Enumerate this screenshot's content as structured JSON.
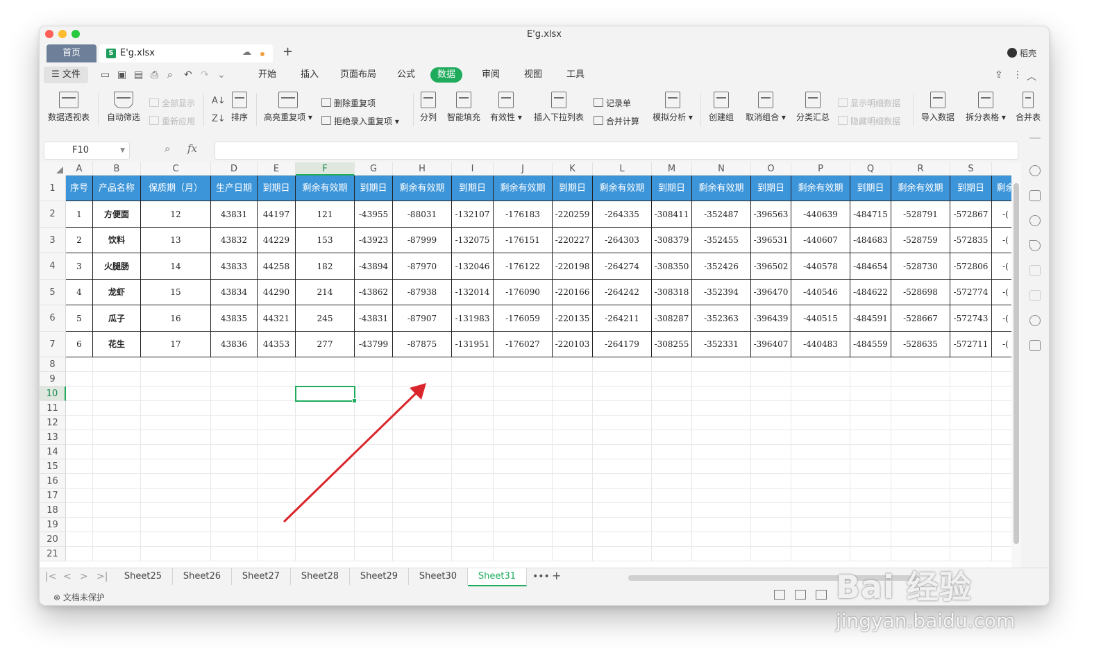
{
  "window": {
    "title": "E'g.xlsx"
  },
  "tabs": {
    "home": "首页",
    "file": "E'g.xlsx",
    "new_tab": "+"
  },
  "user": {
    "name": "稻壳"
  },
  "menu": {
    "file": "文件",
    "tabs": [
      "开始",
      "插入",
      "页面布局",
      "公式",
      "数据",
      "审阅",
      "视图",
      "工具"
    ],
    "active": "数据"
  },
  "ribbon": {
    "pivot": "数据透视表",
    "autofilter": "自动筛选",
    "show_all": "全部显示",
    "reapply": "重新应用",
    "sort": "排序",
    "highlight_dup": "高亮重复项",
    "delete_dup": "删除重复项",
    "reject_dup": "拒绝录入重复项",
    "split_col": "分列",
    "smart_fill": "智能填充",
    "validity": "有效性",
    "insert_dropdown": "插入下拉列表",
    "record_sheet": "记录单",
    "consolidate": "合并计算",
    "whatif": "模拟分析",
    "create_group": "创建组",
    "ungroup": "取消组合",
    "subtotal": "分类汇总",
    "show_detail": "显示明细数据",
    "hide_detail": "隐藏明细数据",
    "import_data": "导入数据",
    "split_table": "拆分表格",
    "merge_table": "合并表"
  },
  "formula_bar": {
    "name_box": "F10",
    "fx": "fx",
    "content": ""
  },
  "grid": {
    "columns": [
      "A",
      "B",
      "C",
      "D",
      "E",
      "F",
      "G",
      "H",
      "I",
      "J",
      "K",
      "L",
      "M",
      "N",
      "O",
      "P",
      "Q",
      "R",
      "S",
      ""
    ],
    "rows": [
      "1",
      "2",
      "3",
      "4",
      "5",
      "6",
      "7",
      "8",
      "9",
      "10",
      "11",
      "12",
      "13",
      "14",
      "15",
      "16",
      "17",
      "18",
      "19",
      "20",
      "21"
    ],
    "selected_cell": "F10",
    "header": [
      "序号",
      "产品名称",
      "保质期（月）",
      "生产日期",
      "到期日",
      "剩余有效期",
      "到期日",
      "剩余有效期",
      "到期日",
      "剩余有效期",
      "到期日",
      "剩余有效期",
      "到期日",
      "剩余有效期",
      "到期日",
      "剩余有效期",
      "到期日",
      "剩余有效期",
      "到期日",
      "剩余"
    ],
    "data": [
      [
        "1",
        "方便面",
        "12",
        "43831",
        "44197",
        "121",
        "-43955",
        "-88031",
        "-132107",
        "-176183",
        "-220259",
        "-264335",
        "-308411",
        "-352487",
        "-396563",
        "-440639",
        "-484715",
        "-528791",
        "-572867",
        "-("
      ],
      [
        "2",
        "饮料",
        "13",
        "43832",
        "44229",
        "153",
        "-43923",
        "-87999",
        "-132075",
        "-176151",
        "-220227",
        "-264303",
        "-308379",
        "-352455",
        "-396531",
        "-440607",
        "-484683",
        "-528759",
        "-572835",
        "-("
      ],
      [
        "3",
        "火腿肠",
        "14",
        "43833",
        "44258",
        "182",
        "-43894",
        "-87970",
        "-132046",
        "-176122",
        "-220198",
        "-264274",
        "-308350",
        "-352426",
        "-396502",
        "-440578",
        "-484654",
        "-528730",
        "-572806",
        "-("
      ],
      [
        "4",
        "龙虾",
        "15",
        "43834",
        "44290",
        "214",
        "-43862",
        "-87938",
        "-132014",
        "-176090",
        "-220166",
        "-264242",
        "-308318",
        "-352394",
        "-396470",
        "-440546",
        "-484622",
        "-528698",
        "-572774",
        "-("
      ],
      [
        "5",
        "瓜子",
        "16",
        "43835",
        "44321",
        "245",
        "-43831",
        "-87907",
        "-131983",
        "-176059",
        "-220135",
        "-264211",
        "-308287",
        "-352363",
        "-396439",
        "-440515",
        "-484591",
        "-528667",
        "-572743",
        "-("
      ],
      [
        "6",
        "花生",
        "17",
        "43836",
        "44353",
        "277",
        "-43799",
        "-87875",
        "-131951",
        "-176027",
        "-220103",
        "-264179",
        "-308255",
        "-352331",
        "-396407",
        "-440483",
        "-484559",
        "-528635",
        "-572711",
        "-("
      ]
    ]
  },
  "sheets": {
    "tabs": [
      "Sheet25",
      "Sheet26",
      "Sheet27",
      "Sheet28",
      "Sheet29",
      "Sheet30",
      "Sheet31"
    ],
    "active": "Sheet31",
    "more": "•••",
    "add": "+"
  },
  "status": {
    "protection": "文档未保护"
  },
  "watermark": {
    "logo": "Bai 经验",
    "url": "jingyan.baidu.com"
  },
  "colors": {
    "accent": "#1fab5c",
    "header_fill": "#3d95d9",
    "arrow": "#d9262c"
  }
}
